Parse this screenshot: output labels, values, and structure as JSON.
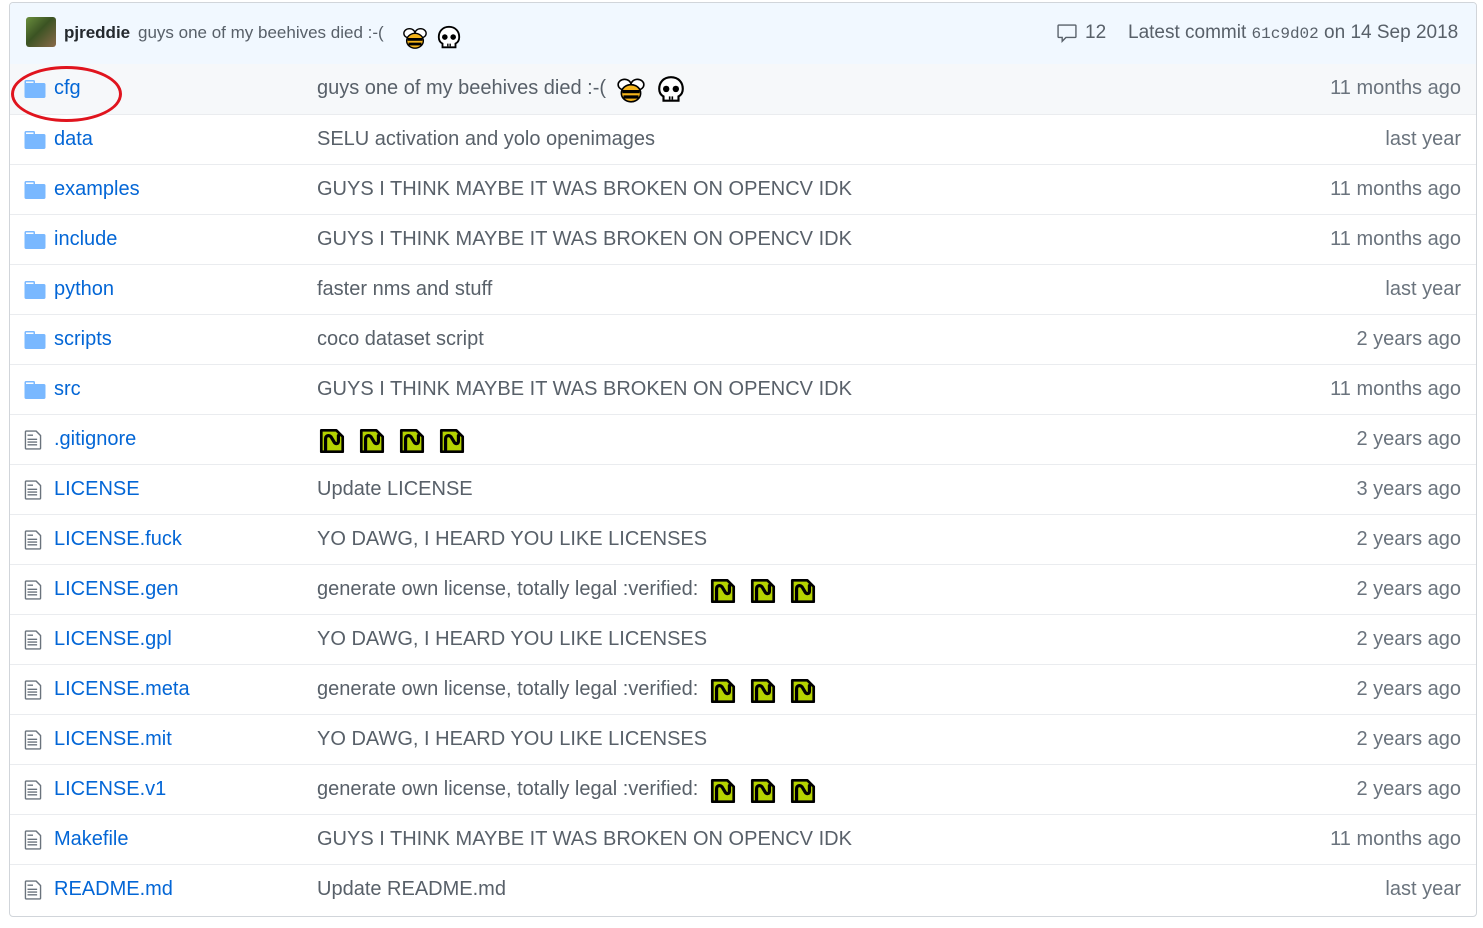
{
  "header": {
    "author": "pjreddie",
    "message": "guys one of my beehives died :-(",
    "message_emoji": [
      "bee-emoji",
      "skull-emoji"
    ],
    "comment_count": "12",
    "latest_commit_label": "Latest commit",
    "commit_sha": "61c9d02",
    "commit_date": "on 14 Sep 2018"
  },
  "files": [
    {
      "name": "cfg",
      "type": "dir",
      "message": "guys one of my beehives died :-(",
      "emoji": [
        "bee-emoji",
        "skull-emoji"
      ],
      "age": "11 months ago"
    },
    {
      "name": "data",
      "type": "dir",
      "message": "SELU activation and yolo openimages",
      "emoji": [],
      "age": "last year"
    },
    {
      "name": "examples",
      "type": "dir",
      "message": "GUYS I THINK MAYBE IT WAS BROKEN ON OPENCV IDK",
      "emoji": [],
      "age": "11 months ago"
    },
    {
      "name": "include",
      "type": "dir",
      "message": "GUYS I THINK MAYBE IT WAS BROKEN ON OPENCV IDK",
      "emoji": [],
      "age": "11 months ago"
    },
    {
      "name": "python",
      "type": "dir",
      "message": "faster nms and stuff",
      "emoji": [],
      "age": "last year"
    },
    {
      "name": "scripts",
      "type": "dir",
      "message": "coco dataset script",
      "emoji": [],
      "age": "2 years ago"
    },
    {
      "name": "src",
      "type": "dir",
      "message": "GUYS I THINK MAYBE IT WAS BROKEN ON OPENCV IDK",
      "emoji": [],
      "age": "11 months ago"
    },
    {
      "name": ".gitignore",
      "type": "file",
      "message": "",
      "emoji": [
        "verified-emoji",
        "verified-emoji",
        "verified-emoji",
        "verified-emoji"
      ],
      "age": "2 years ago"
    },
    {
      "name": "LICENSE",
      "type": "file",
      "message": "Update LICENSE",
      "emoji": [],
      "age": "3 years ago"
    },
    {
      "name": "LICENSE.fuck",
      "type": "file",
      "message": "YO DAWG, I HEARD YOU LIKE LICENSES",
      "emoji": [],
      "age": "2 years ago"
    },
    {
      "name": "LICENSE.gen",
      "type": "file",
      "message": "generate own license, totally legal :verified:",
      "emoji": [
        "verified-emoji",
        "verified-emoji",
        "verified-emoji"
      ],
      "age": "2 years ago"
    },
    {
      "name": "LICENSE.gpl",
      "type": "file",
      "message": "YO DAWG, I HEARD YOU LIKE LICENSES",
      "emoji": [],
      "age": "2 years ago"
    },
    {
      "name": "LICENSE.meta",
      "type": "file",
      "message": "generate own license, totally legal :verified:",
      "emoji": [
        "verified-emoji",
        "verified-emoji",
        "verified-emoji"
      ],
      "age": "2 years ago"
    },
    {
      "name": "LICENSE.mit",
      "type": "file",
      "message": "YO DAWG, I HEARD YOU LIKE LICENSES",
      "emoji": [],
      "age": "2 years ago"
    },
    {
      "name": "LICENSE.v1",
      "type": "file",
      "message": "generate own license, totally legal :verified:",
      "emoji": [
        "verified-emoji",
        "verified-emoji",
        "verified-emoji"
      ],
      "age": "2 years ago"
    },
    {
      "name": "Makefile",
      "type": "file",
      "message": "GUYS I THINK MAYBE IT WAS BROKEN ON OPENCV IDK",
      "emoji": [],
      "age": "11 months ago"
    },
    {
      "name": "README.md",
      "type": "file",
      "message": "Update README.md",
      "emoji": [],
      "age": "last year"
    }
  ],
  "colors": {
    "link": "#0366d6",
    "muted": "#586069",
    "header_bg": "#f1f8ff",
    "folder_icon": "#79b8ff",
    "highlight_circle": "#e0141e"
  }
}
